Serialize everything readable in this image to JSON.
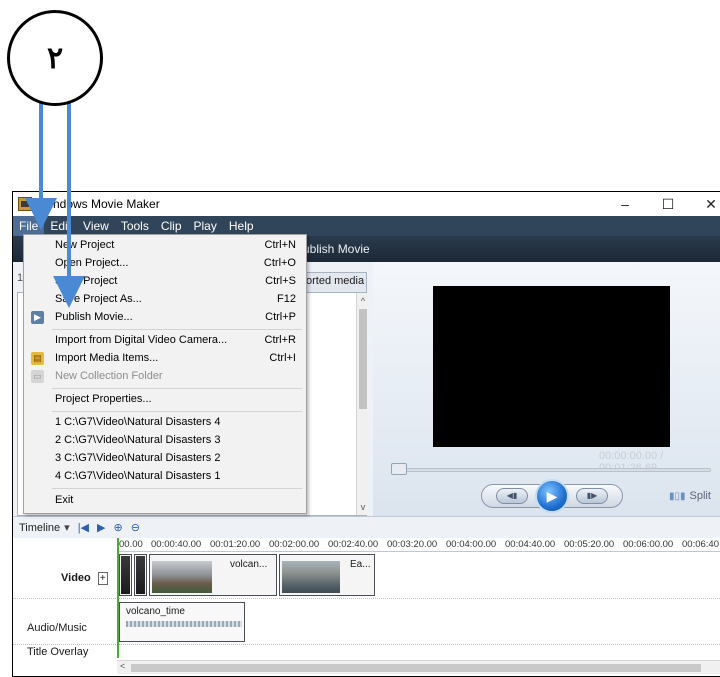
{
  "annotation": {
    "badge_text": "٢"
  },
  "window": {
    "title": "Windows Movie Maker",
    "controls": {
      "minimize": "–",
      "maximize": "☐",
      "close": "✕"
    }
  },
  "menubar": [
    "File",
    "Edit",
    "View",
    "Tools",
    "Clip",
    "Play",
    "Help"
  ],
  "taskstrip": {
    "partial_button": "ublish Movie"
  },
  "collection": {
    "tab_partial": "orted media",
    "left_edge_text": "1"
  },
  "file_menu": {
    "groups": [
      [
        {
          "label": "New Project",
          "shortcut": "Ctrl+N"
        },
        {
          "label": "Open Project...",
          "shortcut": "Ctrl+O"
        },
        {
          "label": "Save Project",
          "shortcut": "Ctrl+S"
        },
        {
          "label": "Save Project As...",
          "shortcut": "F12"
        },
        {
          "label": "Publish Movie...",
          "shortcut": "Ctrl+P"
        }
      ],
      [
        {
          "label": "Import from Digital Video Camera...",
          "shortcut": "Ctrl+R"
        },
        {
          "label": "Import Media Items...",
          "shortcut": "Ctrl+I"
        },
        {
          "label": "New Collection Folder",
          "shortcut": ""
        }
      ],
      [
        {
          "label": "Project Properties...",
          "shortcut": ""
        }
      ],
      [
        {
          "label": "1 C:\\G7\\Video\\Natural Disasters 4",
          "shortcut": ""
        },
        {
          "label": "2 C:\\G7\\Video\\Natural Disasters 3",
          "shortcut": ""
        },
        {
          "label": "3 C:\\G7\\Video\\Natural Disasters 2",
          "shortcut": ""
        },
        {
          "label": "4 C:\\G7\\Video\\Natural Disasters 1",
          "shortcut": ""
        }
      ],
      [
        {
          "label": "Exit",
          "shortcut": ""
        }
      ]
    ]
  },
  "preview": {
    "timecode": "00:00:00.00 / 00:01:26.69",
    "split_label": "Split",
    "seek_position": 0
  },
  "timeline": {
    "label": "Timeline",
    "ruler": [
      "00.00",
      "00:00:40.00",
      "00:01:20.00",
      "00:02:00.00",
      "00:02:40.00",
      "00:03:20.00",
      "00:04:00.00",
      "00:04:40.00",
      "00:05:20.00",
      "00:06:00.00",
      "00:06:40"
    ],
    "tracks": {
      "video": "Video",
      "audio": "Audio/Music",
      "title": "Title Overlay"
    },
    "video_clips": [
      "volcan...",
      "Ea..."
    ],
    "audio_clip": "volcano_time"
  },
  "colors": {
    "menubar": "#31455a",
    "annotation_arrow": "#4a8ad4",
    "playhead": "#43b02a"
  }
}
